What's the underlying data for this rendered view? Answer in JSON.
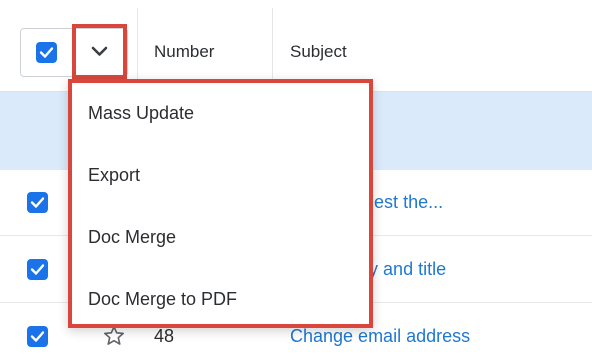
{
  "colors": {
    "accent": "#1a73e8",
    "highlight": "#d9473c",
    "link": "#1f78d1"
  },
  "header": {
    "select_all_checked": true,
    "actions_icon": "chevron-down-icon",
    "columns": [
      "Number",
      "Subject"
    ]
  },
  "actions_menu": {
    "items": [
      "Mass Update",
      "Export",
      "Doc Merge",
      "Doc Merge to PDF"
    ]
  },
  "rows": [
    {
      "checked": true,
      "number": "",
      "subject": "ike to request the..."
    },
    {
      "checked": true,
      "number": "",
      "subject": "e company and title"
    },
    {
      "checked": true,
      "favorite_icon": "star-outline-icon",
      "number": "48",
      "subject": "Change email address"
    }
  ]
}
